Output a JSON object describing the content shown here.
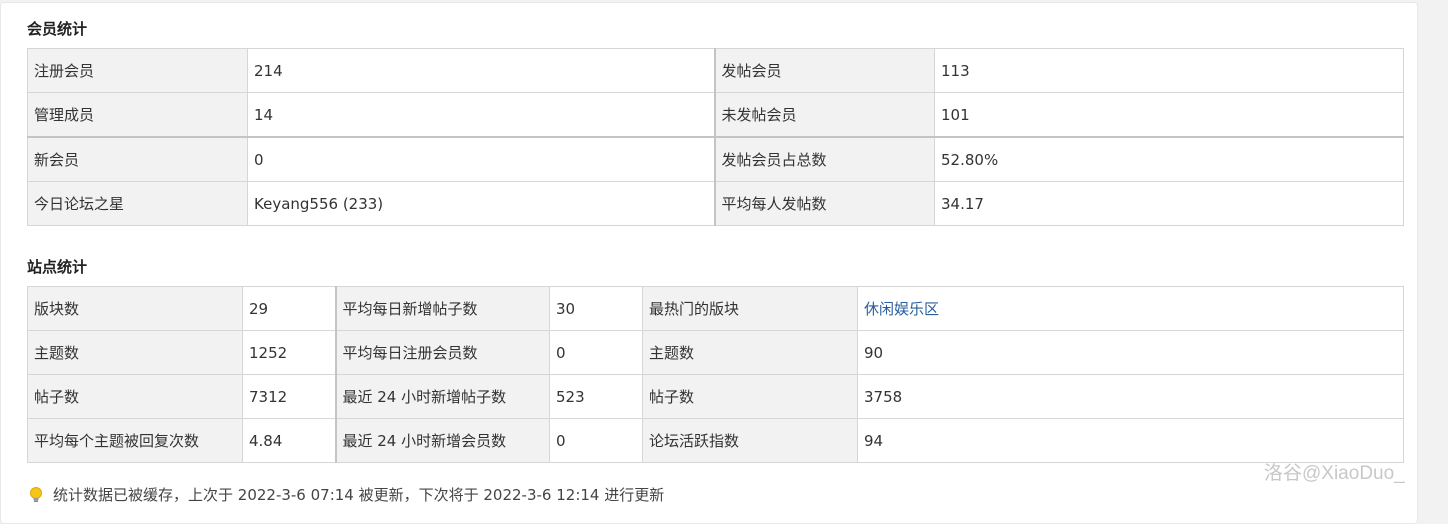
{
  "member_stats": {
    "title": "会员统计",
    "rows": [
      [
        {
          "label": "注册会员",
          "value": "214"
        },
        {
          "label": "发帖会员",
          "value": "113"
        }
      ],
      [
        {
          "label": "管理成员",
          "value": "14"
        },
        {
          "label": "未发帖会员",
          "value": "101"
        }
      ],
      [
        {
          "label": "新会员",
          "value": "0"
        },
        {
          "label": "发帖会员占总数",
          "value": "52.80%"
        }
      ],
      [
        {
          "label": "今日论坛之星",
          "value": "Keyang556 (233)"
        },
        {
          "label": "平均每人发帖数",
          "value": "34.17"
        }
      ]
    ]
  },
  "site_stats": {
    "title": "站点统计",
    "rows": [
      [
        {
          "label": "版块数",
          "value": "29"
        },
        {
          "label": "平均每日新增帖子数",
          "value": "30"
        },
        {
          "label": "最热门的版块",
          "value": "休闲娱乐区"
        }
      ],
      [
        {
          "label": "主题数",
          "value": "1252"
        },
        {
          "label": "平均每日注册会员数",
          "value": "0"
        },
        {
          "label": "主题数",
          "value": "90"
        }
      ],
      [
        {
          "label": "帖子数",
          "value": "7312"
        },
        {
          "label": "最近 24 小时新增帖子数",
          "value": "523"
        },
        {
          "label": "帖子数",
          "value": "3758"
        }
      ],
      [
        {
          "label": "平均每个主题被回复次数",
          "value": "4.84"
        },
        {
          "label": "最近 24 小时新增会员数",
          "value": "0"
        },
        {
          "label": "论坛活跃指数",
          "value": "94"
        }
      ]
    ]
  },
  "footer": {
    "icon": "lightbulb-icon",
    "text": "统计数据已被缓存，上次于 2022-3-6 07:14 被更新，下次将于 2022-3-6 12:14 进行更新"
  },
  "watermark": "洛谷@XiaoDuo_",
  "colors": {
    "label_bg": "#f2f2f2",
    "link": "#2a5d9f",
    "bulb": "#f5c518"
  }
}
